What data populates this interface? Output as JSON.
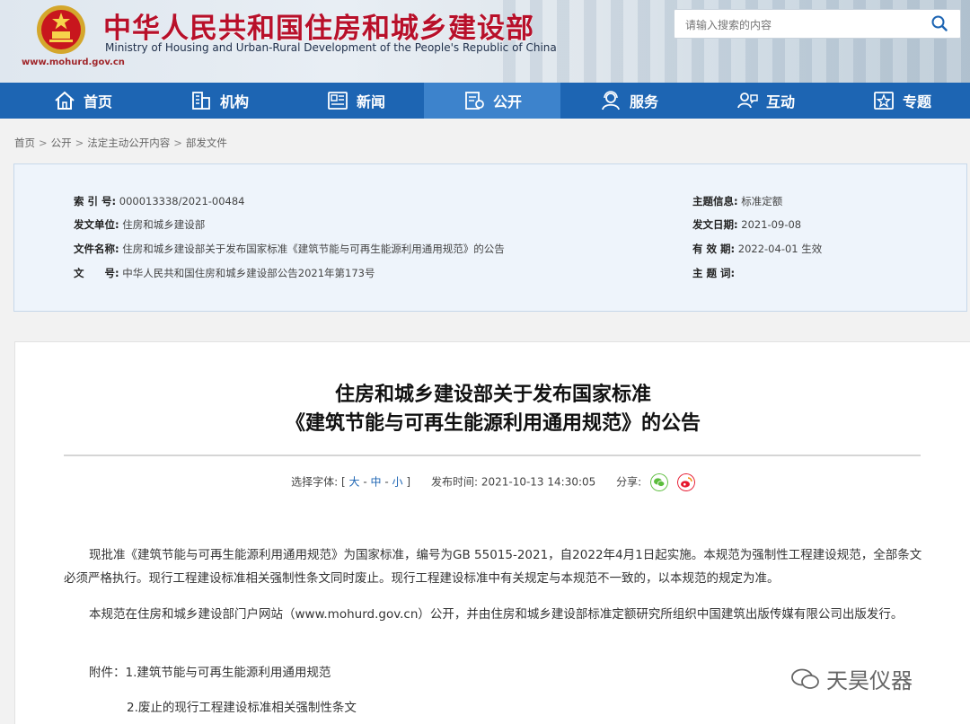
{
  "header": {
    "title_cn": "中华人民共和国住房和城乡建设部",
    "title_en": "Ministry of Housing and Urban-Rural Development of the People's Republic of China",
    "url": "www.mohurd.gov.cn",
    "search_placeholder": "请输入搜索的内容"
  },
  "nav": {
    "items": [
      {
        "label": "首页",
        "icon": "home-icon"
      },
      {
        "label": "机构",
        "icon": "building-icon"
      },
      {
        "label": "新闻",
        "icon": "news-icon"
      },
      {
        "label": "公开",
        "icon": "document-icon"
      },
      {
        "label": "服务",
        "icon": "service-icon"
      },
      {
        "label": "互动",
        "icon": "interact-icon"
      },
      {
        "label": "专题",
        "icon": "topic-icon"
      }
    ],
    "active": "公开"
  },
  "breadcrumb": [
    "首页",
    "公开",
    "法定主动公开内容",
    "部发文件"
  ],
  "info": {
    "index_label": "索 引 号:",
    "index_value": "000013338/2021-00484",
    "issuer_label": "发文单位:",
    "issuer_value": "住房和城乡建设部",
    "name_label": "文件名称:",
    "name_value": "住房和城乡建设部关于发布国家标准《建筑节能与可再生能源利用通用规范》的公告",
    "docno_label": "文　　号:",
    "docno_value": "中华人民共和国住房和城乡建设部公告2021年第173号",
    "topic_label": "主题信息:",
    "topic_value": "标准定额",
    "date_label": "发文日期:",
    "date_value": "2021-09-08",
    "valid_label": "有 效 期:",
    "valid_value": "2022-04-01 生效",
    "keyword_label": "主 题 词:",
    "keyword_value": ""
  },
  "article": {
    "title_line1": "住房和城乡建设部关于发布国家标准",
    "title_line2": "《建筑节能与可再生能源利用通用规范》的公告",
    "fontsize_label": "选择字体:",
    "fs_open": "[",
    "fs_large": "大",
    "fs_mid": "中",
    "fs_small": "小",
    "fs_close": "]",
    "publish_label": "发布时间:",
    "publish_time": "2021-10-13 14:30:05",
    "share_label": "分享:",
    "para1": "现批准《建筑节能与可再生能源利用通用规范》为国家标准，编号为GB 55015-2021，自2022年4月1日起实施。本规范为强制性工程建设规范，全部条文必须严格执行。现行工程建设标准相关强制性条文同时废止。现行工程建设标准中有关规定与本规范不一致的，以本规范的规定为准。",
    "para2": "本规范在住房和城乡建设部门户网站（www.mohurd.gov.cn）公开，并由住房和城乡建设部标准定额研究所组织中国建筑出版传媒有限公司出版发行。",
    "attach1": "附件：1.建筑节能与可再生能源利用通用规范",
    "attach2": "2.废止的现行工程建设标准相关强制性条文"
  },
  "watermark": "天昊仪器",
  "colors": {
    "brand_red": "#b8102a",
    "nav_blue": "#1d65b3",
    "nav_active": "#3d83cc"
  }
}
